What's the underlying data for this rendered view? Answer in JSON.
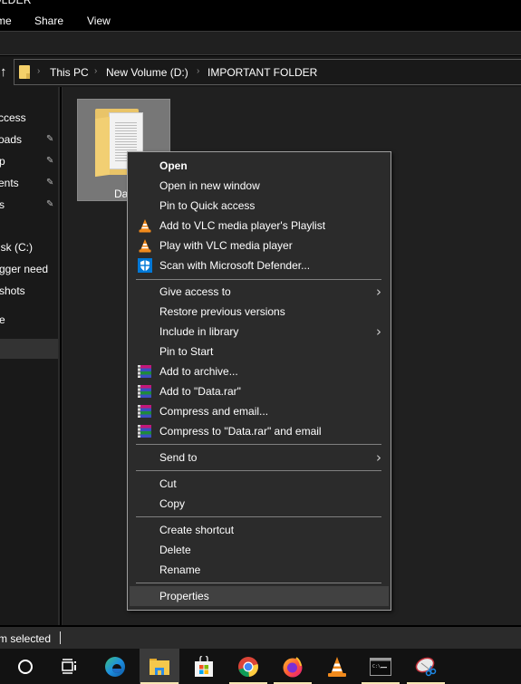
{
  "window": {
    "title_fragment": "OLDER"
  },
  "ribbon": {
    "tabs": [
      "me",
      "Share",
      "View"
    ]
  },
  "address_bar": {
    "crumbs": [
      "This PC",
      "New Volume (D:)",
      "IMPORTANT FOLDER"
    ],
    "separator": "›",
    "up_icon": "↑"
  },
  "sidebar": {
    "items": [
      {
        "label": "ccess",
        "pinned": false
      },
      {
        "label": "oads",
        "pinned": true
      },
      {
        "label": "p",
        "pinned": true
      },
      {
        "label": "ents",
        "pinned": true
      },
      {
        "label": "s",
        "pinned": true
      },
      {
        "label": "isk (C:)",
        "pinned": false
      },
      {
        "label": "gger need",
        "pinned": false
      },
      {
        "label": "shots",
        "pinned": false
      },
      {
        "label": "e",
        "pinned": false
      },
      {
        "label": "",
        "pinned": false,
        "selected": true
      }
    ],
    "pin_glyph": "📌"
  },
  "content": {
    "folder": {
      "name": "Dat"
    }
  },
  "context_menu": {
    "items": [
      {
        "label": "Open",
        "bold": true
      },
      {
        "label": "Open in new window"
      },
      {
        "label": "Pin to Quick access"
      },
      {
        "label": "Add to VLC media player's Playlist",
        "icon": "vlc-icon"
      },
      {
        "label": "Play with VLC media player",
        "icon": "vlc-icon"
      },
      {
        "label": "Scan with Microsoft Defender...",
        "icon": "defender-icon"
      },
      {
        "separator": true
      },
      {
        "label": "Give access to",
        "submenu": true
      },
      {
        "label": "Restore previous versions"
      },
      {
        "label": "Include in library",
        "submenu": true
      },
      {
        "label": "Pin to Start"
      },
      {
        "label": "Add to archive...",
        "icon": "winrar-icon"
      },
      {
        "label": "Add to \"Data.rar\"",
        "icon": "winrar-icon"
      },
      {
        "label": "Compress and email...",
        "icon": "winrar-icon"
      },
      {
        "label": "Compress to \"Data.rar\" and email",
        "icon": "winrar-icon"
      },
      {
        "separator": true
      },
      {
        "label": "Send to",
        "submenu": true
      },
      {
        "separator": true
      },
      {
        "label": "Cut"
      },
      {
        "label": "Copy"
      },
      {
        "separator": true
      },
      {
        "label": "Create shortcut"
      },
      {
        "label": "Delete"
      },
      {
        "label": "Rename"
      },
      {
        "separator": true
      },
      {
        "label": "Properties",
        "hover": true
      }
    ],
    "submenu_glyph": "〉"
  },
  "status_bar": {
    "text": "m selected"
  },
  "taskbar": {
    "items": [
      {
        "name": "cortana",
        "running": false
      },
      {
        "name": "task-view",
        "running": false
      },
      {
        "name": "edge",
        "running": false
      },
      {
        "name": "file-explorer",
        "running": true,
        "active": true
      },
      {
        "name": "microsoft-store",
        "running": false
      },
      {
        "name": "chrome",
        "running": true
      },
      {
        "name": "firefox",
        "running": true
      },
      {
        "name": "vlc",
        "running": false
      },
      {
        "name": "command-prompt",
        "running": true
      },
      {
        "name": "snipping-tool",
        "running": true
      }
    ]
  },
  "colors": {
    "folder_yellow": "#f4d06a",
    "menu_bg": "#2b2b2b",
    "menu_hover": "#414141",
    "taskbar_running_indicator": "#f7e6b3"
  }
}
